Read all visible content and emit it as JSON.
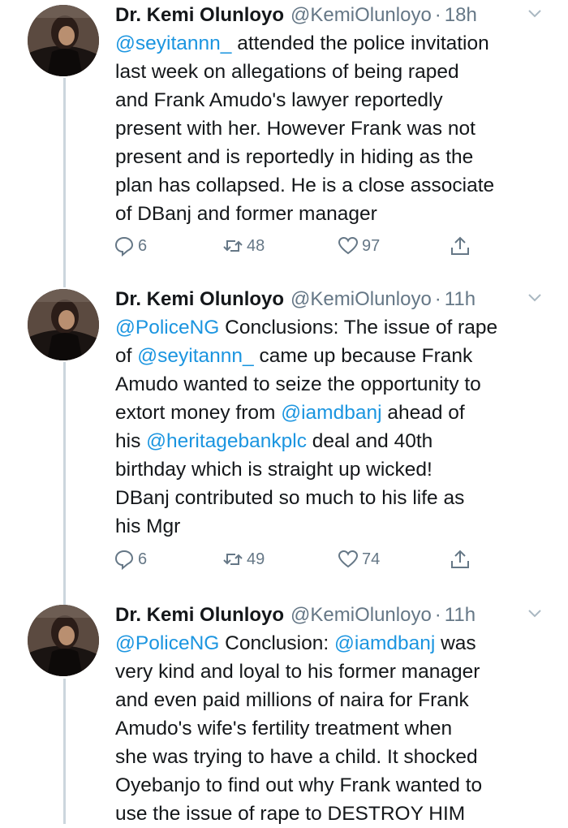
{
  "tweets": [
    {
      "name": "Dr. Kemi Olunloyo",
      "handle": "@KemiOlunloyo",
      "time": "18h",
      "lines": [
        [
          {
            "m": true,
            "t": "@seyitannn_"
          },
          {
            "m": false,
            "t": " attended the police invitation"
          }
        ],
        [
          {
            "m": false,
            "t": "last week on allegations of being raped"
          }
        ],
        [
          {
            "m": false,
            "t": "and Frank Amudo's lawyer reportedly"
          }
        ],
        [
          {
            "m": false,
            "t": "present with her. However Frank was not"
          }
        ],
        [
          {
            "m": false,
            "t": "present and is reportedly in hiding as the"
          }
        ],
        [
          {
            "m": false,
            "t": "plan has collapsed. He is a close associate"
          }
        ],
        [
          {
            "m": false,
            "t": "of DBanj and former manager"
          }
        ]
      ],
      "replies": "6",
      "retweets": "48",
      "likes": "97"
    },
    {
      "name": "Dr. Kemi Olunloyo",
      "handle": "@KemiOlunloyo",
      "time": "11h",
      "lines": [
        [
          {
            "m": true,
            "t": "@PoliceNG"
          },
          {
            "m": false,
            "t": " Conclusions: The issue of rape"
          }
        ],
        [
          {
            "m": false,
            "t": "of "
          },
          {
            "m": true,
            "t": "@seyitannn_"
          },
          {
            "m": false,
            "t": " came up because Frank"
          }
        ],
        [
          {
            "m": false,
            "t": "Amudo wanted to seize the opportunity to"
          }
        ],
        [
          {
            "m": false,
            "t": "extort money from "
          },
          {
            "m": true,
            "t": "@iamdbanj"
          },
          {
            "m": false,
            "t": " ahead of"
          }
        ],
        [
          {
            "m": false,
            "t": "his "
          },
          {
            "m": true,
            "t": "@heritagebankplc"
          },
          {
            "m": false,
            "t": " deal and 40th"
          }
        ],
        [
          {
            "m": false,
            "t": "birthday which is straight up wicked!"
          }
        ],
        [
          {
            "m": false,
            "t": "DBanj contributed so much to his life as"
          }
        ],
        [
          {
            "m": false,
            "t": "his Mgr"
          }
        ]
      ],
      "replies": "6",
      "retweets": "49",
      "likes": "74"
    },
    {
      "name": "Dr. Kemi Olunloyo",
      "handle": "@KemiOlunloyo",
      "time": "11h",
      "lines": [
        [
          {
            "m": true,
            "t": "@PoliceNG"
          },
          {
            "m": false,
            "t": " Conclusion: "
          },
          {
            "m": true,
            "t": "@iamdbanj"
          },
          {
            "m": false,
            "t": " was"
          }
        ],
        [
          {
            "m": false,
            "t": "very kind and loyal to his former manager"
          }
        ],
        [
          {
            "m": false,
            "t": "and even paid millions of naira for Frank"
          }
        ],
        [
          {
            "m": false,
            "t": "Amudo's wife's fertility treatment when"
          }
        ],
        [
          {
            "m": false,
            "t": "she was trying to have a child. It shocked"
          }
        ],
        [
          {
            "m": false,
            "t": "Oyebanjo to find out why Frank wanted to"
          }
        ],
        [
          {
            "m": false,
            "t": "use the issue of rape to DESTROY HIM"
          }
        ]
      ],
      "replies": "",
      "retweets": "",
      "likes": ""
    }
  ],
  "icons": {
    "reply": "reply-icon",
    "retweet": "retweet-icon",
    "like": "heart-icon",
    "share": "share-icon",
    "menu": "chevron-down-icon"
  },
  "colors": {
    "mention": "#1b95e0",
    "secondary_text": "#657786",
    "thread_line": "#ccd6dd"
  }
}
